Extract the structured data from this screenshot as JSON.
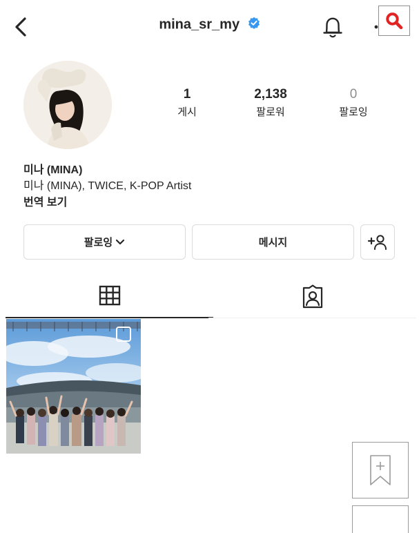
{
  "header": {
    "username": "mina_sr_my",
    "icons": {
      "back": "chevron-left-icon",
      "verified": "verified-badge-icon",
      "notifications": "bell-icon",
      "more": "more-icon",
      "search": "search-icon"
    }
  },
  "profile": {
    "stats": [
      {
        "value": "1",
        "label": "게시"
      },
      {
        "value": "2,138",
        "label": "팔로워"
      },
      {
        "value": "0",
        "label": "팔로잉"
      }
    ],
    "bio": {
      "name": "미나 (MINA)",
      "description": "미나 (MINA), TWICE, K-POP Artist",
      "translate": "번역 보기"
    }
  },
  "actions": {
    "follow_label": "팔로잉",
    "message_label": "메시지",
    "add_person_icon": "add-person-icon"
  },
  "tabs": {
    "grid_icon": "grid-icon",
    "tagged_icon": "tagged-icon"
  },
  "colors": {
    "verified": "#3897f0",
    "search_accent": "#e02424",
    "text": "#262626",
    "muted": "#8e8e8e",
    "border": "#dbdbdb"
  }
}
